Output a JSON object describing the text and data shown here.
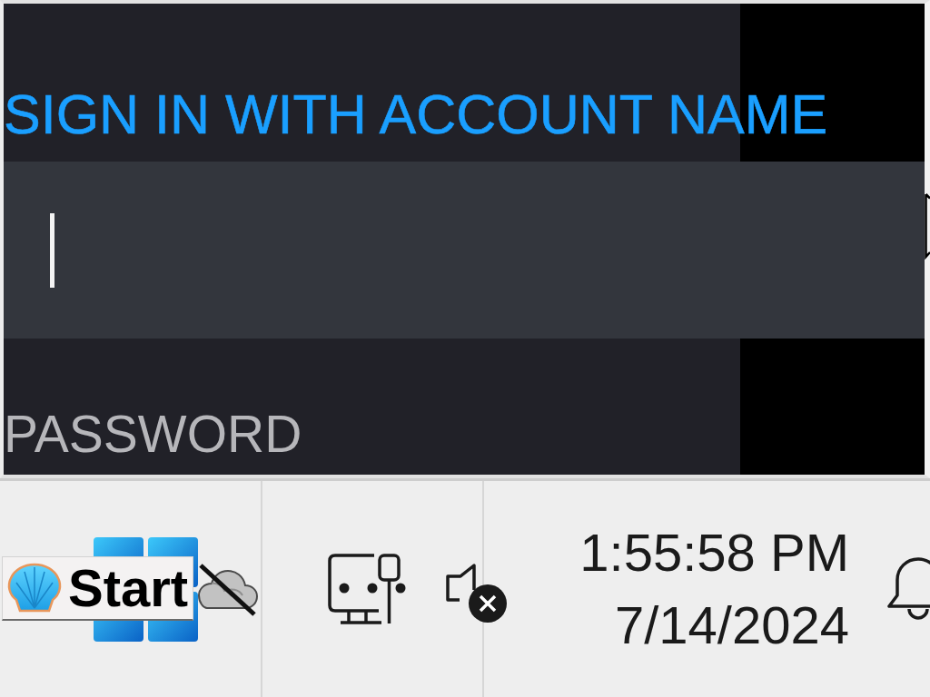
{
  "window": {
    "heading": "SIGN IN WITH ACCOUNT NAME",
    "account_field": {
      "focused": true
    },
    "password_label": "PASSWORD"
  },
  "taskbar": {
    "start_button": {
      "label": "Start"
    },
    "tray_icons": [
      {
        "kind": "cloud",
        "disconnected": true
      },
      {
        "kind": "network"
      },
      {
        "kind": "speaker",
        "muted": true
      }
    ],
    "clock": {
      "time": "1:55:58 PM",
      "date": "7/14/2024"
    }
  }
}
